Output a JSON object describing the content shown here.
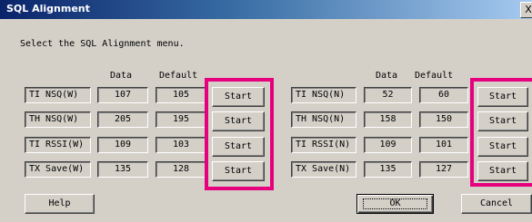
{
  "window": {
    "title": "SQL Alignment",
    "close_glyph": "X"
  },
  "instruction": "Select the SQL Alignment menu.",
  "left": {
    "data_header": "Data",
    "default_header": "Default",
    "rows": [
      {
        "label": "TI NSQ(W)",
        "data": "107",
        "default": "105",
        "button": "Start"
      },
      {
        "label": "TH NSQ(W)",
        "data": "205",
        "default": "195",
        "button": "Start"
      },
      {
        "label": "TI RSSI(W)",
        "data": "109",
        "default": "103",
        "button": "Start"
      },
      {
        "label": "TX Save(W)",
        "data": "135",
        "default": "128",
        "button": "Start"
      }
    ]
  },
  "right": {
    "data_header": "Data",
    "default_header": "Default",
    "rows": [
      {
        "label": "TI NSQ(N)",
        "data": "52",
        "default": "60",
        "button": "Start"
      },
      {
        "label": "TH NSQ(N)",
        "data": "158",
        "default": "150",
        "button": "Start"
      },
      {
        "label": "TI RSSI(N)",
        "data": "109",
        "default": "101",
        "button": "Start"
      },
      {
        "label": "TX Save(N)",
        "data": "135",
        "default": "127",
        "button": "Start"
      }
    ]
  },
  "buttons": {
    "help": "Help",
    "ok": "OK",
    "cancel": "Cancel"
  },
  "colors": {
    "highlight": "#e6007e",
    "title_bar": "#0a246a",
    "face": "#d4d0c8"
  }
}
